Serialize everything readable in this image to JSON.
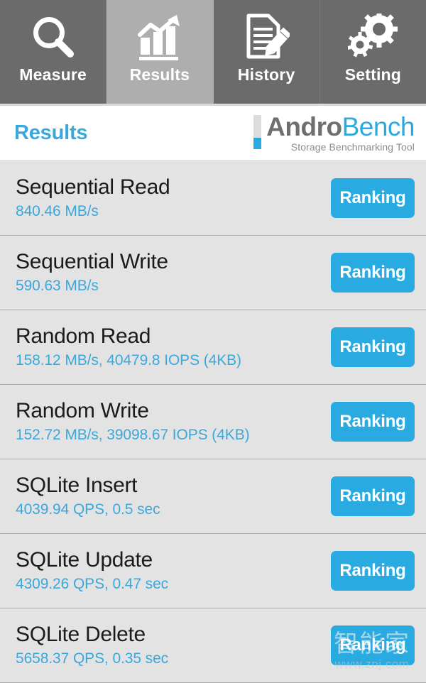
{
  "tabs": [
    {
      "label": "Measure",
      "icon": "magnifier-icon",
      "active": false
    },
    {
      "label": "Results",
      "icon": "bar-chart-trend-icon",
      "active": true
    },
    {
      "label": "History",
      "icon": "document-pencil-icon",
      "active": false
    },
    {
      "label": "Setting",
      "icon": "gears-icon",
      "active": false
    }
  ],
  "header": {
    "title": "Results",
    "logo_primary": "Andro",
    "logo_secondary": "Bench",
    "logo_subtitle": "Storage Benchmarking Tool"
  },
  "results": [
    {
      "name": "Sequential Read",
      "value": "840.46 MB/s",
      "action": "Ranking"
    },
    {
      "name": "Sequential Write",
      "value": "590.63 MB/s",
      "action": "Ranking"
    },
    {
      "name": "Random Read",
      "value": "158.12 MB/s, 40479.8 IOPS (4KB)",
      "action": "Ranking"
    },
    {
      "name": "Random Write",
      "value": "152.72 MB/s, 39098.67 IOPS (4KB)",
      "action": "Ranking"
    },
    {
      "name": "SQLite Insert",
      "value": "4039.94 QPS, 0.5 sec",
      "action": "Ranking"
    },
    {
      "name": "SQLite Update",
      "value": "4309.26 QPS, 0.47 sec",
      "action": "Ranking"
    },
    {
      "name": "SQLite Delete",
      "value": "5658.37 QPS, 0.35 sec",
      "action": "Ranking"
    }
  ],
  "watermark": {
    "text": "智能家",
    "url": "www.znj.com"
  },
  "colors": {
    "accent_blue": "#29abe2",
    "value_blue": "#3aa8dc",
    "tab_inactive": "#6b6b6b",
    "tab_active": "#aeaeae",
    "list_background": "#e3e3e3",
    "row_divider": "#a9a9a9"
  }
}
